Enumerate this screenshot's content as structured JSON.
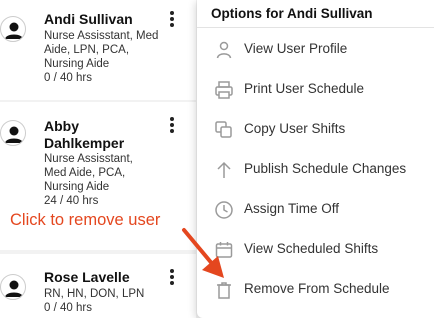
{
  "staff_list": [
    {
      "name": "Andi Sullivan",
      "roles": "Nurse Assisstant, Med Aide, LPN, PCA, Nursing Aide",
      "hours": "0 / 40 hrs"
    },
    {
      "name": "Abby Dahlkemper",
      "roles": "Nurse Assisstant, Med Aide, PCA, Nursing Aide",
      "hours": "24 / 40 hrs"
    },
    {
      "name": "Rose Lavelle",
      "roles": "RN, HN, DON, LPN",
      "hours": "0 / 40 hrs"
    }
  ],
  "menu": {
    "title": "Options for Andi Sullivan",
    "items": [
      {
        "label": "View User Profile",
        "icon": "person-icon"
      },
      {
        "label": "Print User Schedule",
        "icon": "printer-icon"
      },
      {
        "label": "Copy User Shifts",
        "icon": "copy-icon"
      },
      {
        "label": "Publish Schedule Changes",
        "icon": "arrow-up-icon"
      },
      {
        "label": "Assign Time Off",
        "icon": "clock-icon"
      },
      {
        "label": "View Scheduled Shifts",
        "icon": "calendar-icon"
      },
      {
        "label": "Remove From Schedule",
        "icon": "trash-icon"
      }
    ]
  },
  "annotation": {
    "text": "Click to remove user",
    "color": "#e4471f"
  },
  "colors": {
    "accent_red": "#e4471f",
    "icon_gray": "#9a9a9a"
  }
}
